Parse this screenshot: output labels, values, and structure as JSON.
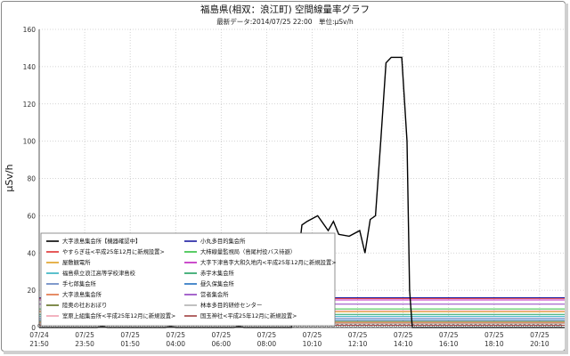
{
  "chart_data": {
    "type": "line",
    "title": "福島県(相双：浪江町) 空間線量率グラフ",
    "subtitle": "最新データ:2014/07/25 22:00　単位:μSv/h",
    "ylabel": "μSv/h",
    "xlabel": "",
    "ylim": [
      0,
      160
    ],
    "yticks": [
      "0",
      "20",
      "40",
      "60",
      "80",
      "100",
      "120",
      "140",
      "160"
    ],
    "xlim": [
      "2014/07/24 21:50",
      "2014/07/25 22:00"
    ],
    "xticks": [
      {
        "date": "07/24",
        "time": "21:50"
      },
      {
        "date": "07/25",
        "time": "23:50"
      },
      {
        "date": "07/25",
        "time": "01:50"
      },
      {
        "date": "07/25",
        "time": "04:00"
      },
      {
        "date": "07/25",
        "time": "06:00"
      },
      {
        "date": "07/25",
        "time": "08:00"
      },
      {
        "date": "07/25",
        "time": "10:10"
      },
      {
        "date": "07/25",
        "time": "12:10"
      },
      {
        "date": "07/25",
        "time": "14:10"
      },
      {
        "date": "07/25",
        "time": "16:10"
      },
      {
        "date": "07/25",
        "time": "18:10"
      },
      {
        "date": "07/25",
        "time": "20:10"
      }
    ],
    "grid": true,
    "legend_position": "lower-left",
    "series": [
      {
        "name": "大字浪島集会所【機器確認中】",
        "color": "#000000",
        "points": [
          [
            0,
            0
          ],
          [
            0.11,
            0
          ],
          [
            0.12,
            0.5
          ],
          [
            0.13,
            0
          ],
          [
            0.24,
            0
          ],
          [
            0.25,
            0.5
          ],
          [
            0.26,
            0
          ],
          [
            0.37,
            0
          ],
          [
            0.38,
            0.5
          ],
          [
            0.39,
            0
          ],
          [
            0.48,
            0
          ],
          [
            0.49,
            30
          ],
          [
            0.5,
            55
          ],
          [
            0.51,
            57
          ],
          [
            0.53,
            60
          ],
          [
            0.55,
            52
          ],
          [
            0.56,
            57
          ],
          [
            0.57,
            50
          ],
          [
            0.59,
            49
          ],
          [
            0.61,
            52
          ],
          [
            0.62,
            40
          ],
          [
            0.63,
            58
          ],
          [
            0.64,
            60
          ],
          [
            0.65,
            100
          ],
          [
            0.66,
            142
          ],
          [
            0.67,
            145
          ],
          [
            0.69,
            145
          ],
          [
            0.7,
            100
          ],
          [
            0.705,
            20
          ],
          [
            0.71,
            0
          ],
          [
            1.0,
            0
          ]
        ]
      },
      {
        "name": "小丸多目的集会所",
        "color": "#1a1aa0",
        "points": [
          [
            0,
            16
          ],
          [
            1,
            16
          ]
        ]
      },
      {
        "name": "やすらぎ荘<平成25年12月に新規設置>",
        "color": "#e03030",
        "points": [
          [
            0,
            15.5
          ],
          [
            1,
            15.6
          ]
        ]
      },
      {
        "name": "大柿線量監視局（島尾村役バス待避）",
        "color": "#30c040",
        "points": [
          [
            0,
            10
          ],
          [
            1,
            10
          ]
        ]
      },
      {
        "name": "屋敷観電所",
        "color": "#e0a020",
        "points": [
          [
            0,
            8.5
          ],
          [
            1,
            8.5
          ]
        ]
      },
      {
        "name": "大字下津島字大和久地内<平成25年12月に新規設置>",
        "color": "#c020c0",
        "points": [
          [
            0,
            14.8
          ],
          [
            1,
            14.8
          ]
        ]
      },
      {
        "name": "福島県立浪江高等学校津島校",
        "color": "#30b0c0",
        "points": [
          [
            0,
            6
          ],
          [
            1,
            6
          ]
        ]
      },
      {
        "name": "赤宇木集会所",
        "color": "#20a060",
        "points": [
          [
            0,
            7
          ],
          [
            1,
            7
          ]
        ]
      },
      {
        "name": "手七郎集会所",
        "color": "#6080c0",
        "points": [
          [
            0,
            5
          ],
          [
            1,
            5
          ]
        ]
      },
      {
        "name": "昼久保集会所",
        "color": "#2070c0",
        "points": [
          [
            0,
            4
          ],
          [
            1,
            4
          ]
        ]
      },
      {
        "name": "大字浪島集会所",
        "color": "#e07040",
        "points": [
          [
            0,
            2.5
          ],
          [
            1,
            2.5
          ]
        ]
      },
      {
        "name": "営者集会所",
        "color": "#9040c0",
        "points": [
          [
            0,
            12.5
          ],
          [
            1,
            12.5
          ]
        ]
      },
      {
        "name": "陸奥の社おおぼり",
        "color": "#607020",
        "points": [
          [
            0,
            3.2
          ],
          [
            1,
            3.2
          ]
        ]
      },
      {
        "name": "林本多目的研修センター",
        "color": "#b0b0b0",
        "points": [
          [
            0,
            2
          ],
          [
            1,
            2
          ]
        ]
      },
      {
        "name": "室原上組集会所<平成25年12月に新規設置>",
        "color": "#f0a0b0",
        "points": [
          [
            0,
            9
          ],
          [
            1,
            9
          ]
        ]
      },
      {
        "name": "国玉神社<平成25年12月に新規設置>",
        "color": "#a04040",
        "points": [
          [
            0,
            1.2
          ],
          [
            1,
            1.2
          ]
        ]
      }
    ]
  }
}
